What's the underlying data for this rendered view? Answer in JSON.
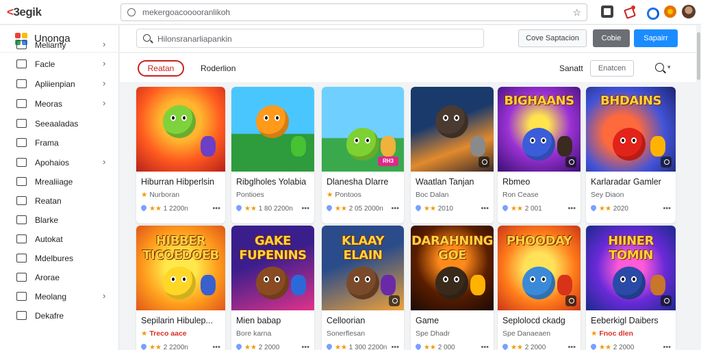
{
  "browser": {
    "brand_part1": "<",
    "brand_part2": "3egik",
    "url": "mekergoacooooranlikoh"
  },
  "app": {
    "name": "Unonga",
    "search_placeholder": "Hilonsranarliapankin",
    "buttons": {
      "outline": "Cove Saptacion",
      "grey": "Cobie",
      "blue": "Sapairr"
    }
  },
  "sidebar": {
    "items": [
      {
        "label": "Meliarny",
        "chevron": true
      },
      {
        "label": "Facle",
        "chevron": true
      },
      {
        "label": "Apliienpian",
        "chevron": true
      },
      {
        "label": "Meoras",
        "chevron": true
      },
      {
        "label": "Seeaaladas",
        "chevron": false
      },
      {
        "label": "Frama",
        "chevron": false
      },
      {
        "label": "Apohaios",
        "chevron": true
      },
      {
        "label": "Mrealiiage",
        "chevron": false
      },
      {
        "label": "Reatan",
        "chevron": false
      },
      {
        "label": "Blarke",
        "chevron": false
      },
      {
        "label": "Autokat",
        "chevron": false
      },
      {
        "label": "Mdelbures",
        "chevron": false
      },
      {
        "label": "Arorae",
        "chevron": false
      },
      {
        "label": "Meolang",
        "chevron": true
      },
      {
        "label": "Dekafre",
        "chevron": false
      }
    ]
  },
  "filters": {
    "active_chip": "Reatan",
    "tab": "Roderlion",
    "sort_label": "Sanatt",
    "sort_value": "Enatcen"
  },
  "cards": [
    {
      "title": "Hiburran Hibperlsin",
      "sub": "Nurboran",
      "meta": "1 2200n",
      "thumb_text": ""
    },
    {
      "title": "Ribglholes Yolabia",
      "sub": "Pontioes",
      "meta": "1 80 2200n",
      "thumb_text": ""
    },
    {
      "title": "Dlanesha Dlarre",
      "sub": "Pontoos",
      "meta": "2 05 2000n",
      "thumb_text": "RH3"
    },
    {
      "title": "Waatlan Tanjan",
      "sub": "Boc Dalan",
      "meta": "2010",
      "thumb_text": ""
    },
    {
      "title": "Rbmeo",
      "sub": "Ron Cease",
      "meta": "2 001",
      "thumb_text": "BIGHAANS"
    },
    {
      "title": "Karlaradar Gamler",
      "sub": "Sey Diaon",
      "meta": "2020",
      "thumb_text": "BHDAINS"
    },
    {
      "title": "Sepilarin Hibulep...",
      "sub": "Treco aace",
      "meta": "2 2200n",
      "thumb_text": "HIBBER TICOEDOEB"
    },
    {
      "title": "Mien babap",
      "sub": "Bore karna",
      "meta": "2 2000",
      "thumb_text": "GAKE FUPENINS"
    },
    {
      "title": "Celloorian",
      "sub": "Sonerflesan",
      "meta": "1 300 2200n",
      "thumb_text": "KLAAY ELAIN"
    },
    {
      "title": "Game",
      "sub": "Spe Dhadr",
      "meta": "2 000",
      "thumb_text": "DARAHNING GOE"
    },
    {
      "title": "Seplolocd ckadg",
      "sub": "Spe Danaeaen",
      "meta": "2 2000",
      "thumb_text": "PHOODAY"
    },
    {
      "title": "Eeberkigl Daibers",
      "sub": "Fnoc dlen",
      "meta": "2 2000",
      "thumb_text": "HIINER TOMIN"
    }
  ]
}
